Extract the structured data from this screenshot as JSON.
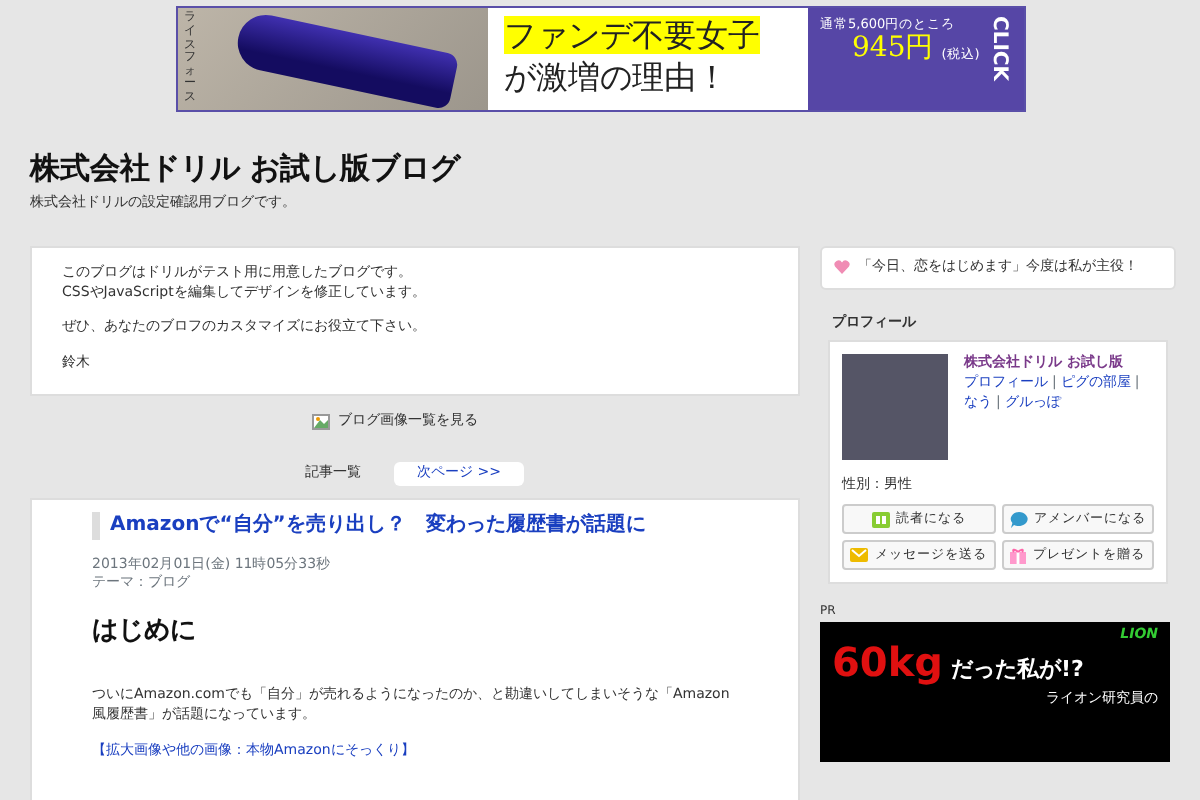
{
  "banner": {
    "product_label": "ライスフォース",
    "headline_1": "ファンデ不要女子",
    "headline_2": "が激増の理由！",
    "price_note": "通常5,600円のところ",
    "price": "945円",
    "tax_note": "(税込)",
    "cta": "CLICK"
  },
  "blog": {
    "title": "株式会社ドリル お試し版ブログ",
    "subtitle": "株式会社ドリルの設定確認用ブログです。"
  },
  "intro": {
    "paragraphs": [
      [
        "このブログはドリルがテスト用に用意したブログです。",
        "CSSやJavaScriptを編集してデザインを修正しています。"
      ],
      [
        "ぜひ、あなたのブロフのカスタマイズにお役立て下さい。"
      ],
      [
        "鈴木"
      ]
    ]
  },
  "image_list_link": "ブログ画像一覧を見る",
  "pagination": {
    "list": "記事一覧",
    "next": "次ページ >>"
  },
  "article": {
    "title": "Amazonで“自分”を売り出し？　変わった履歴書が話題に",
    "date": "2013年02月01日(金) 11時05分33秒",
    "theme_label": "テーマ：",
    "theme": "ブログ",
    "heading": "はじめに",
    "body": "ついにAmazon.comでも「自分」が売れるようになったのか、と勘違いしてしまいそうな「Amazon風履歴書」が話題になっています。",
    "link": "【拡大画像や他の画像：本物Amazonにそっくり】"
  },
  "sidebar": {
    "notice": "「今日、恋をはじめます」今度は私が主役！",
    "profile_heading": "プロフィール",
    "profile": {
      "name": "株式会社ドリル お試し版",
      "links": [
        "プロフィール",
        "ピグの部屋",
        "なう",
        "グルっぽ"
      ],
      "link_separator": "|",
      "gender": "性別：男性",
      "buttons": [
        {
          "kind": "reader",
          "label": "読者になる"
        },
        {
          "kind": "member",
          "label": "アメンバーになる"
        },
        {
          "kind": "message",
          "label": "メッセージを送る"
        },
        {
          "kind": "present",
          "label": "プレゼントを贈る"
        }
      ]
    },
    "pr_label": "PR",
    "ad": {
      "brand": "LION",
      "big": "60kg",
      "rest": "だった私が!?",
      "sub": "ライオン研究員の"
    }
  }
}
